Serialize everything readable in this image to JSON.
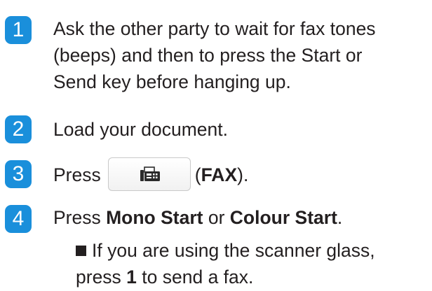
{
  "steps": [
    {
      "number": "1",
      "lines": [
        "Ask the other party to wait for fax tones",
        "(beeps) and then to press the Start or",
        "Send key before hanging up."
      ]
    },
    {
      "number": "2",
      "text": "Load your document."
    },
    {
      "number": "3",
      "press": "Press",
      "paren_open": "(",
      "bold": "FAX",
      "paren_close": ")."
    },
    {
      "number": "4",
      "press": "Press ",
      "bold1": "Mono Start",
      "mid": " or ",
      "bold2": "Colour Start",
      "end": "."
    }
  ],
  "sub_item": {
    "line1": "If you are using the scanner glass,",
    "line2_pre": "press ",
    "line2_bold": "1",
    "line2_post": " to send a fax."
  },
  "icons": {
    "fax_button_icon": "fax-icon",
    "bullet": "square-bullet"
  },
  "colors": {
    "badge": "#1a8fdb",
    "text": "#231f20"
  }
}
